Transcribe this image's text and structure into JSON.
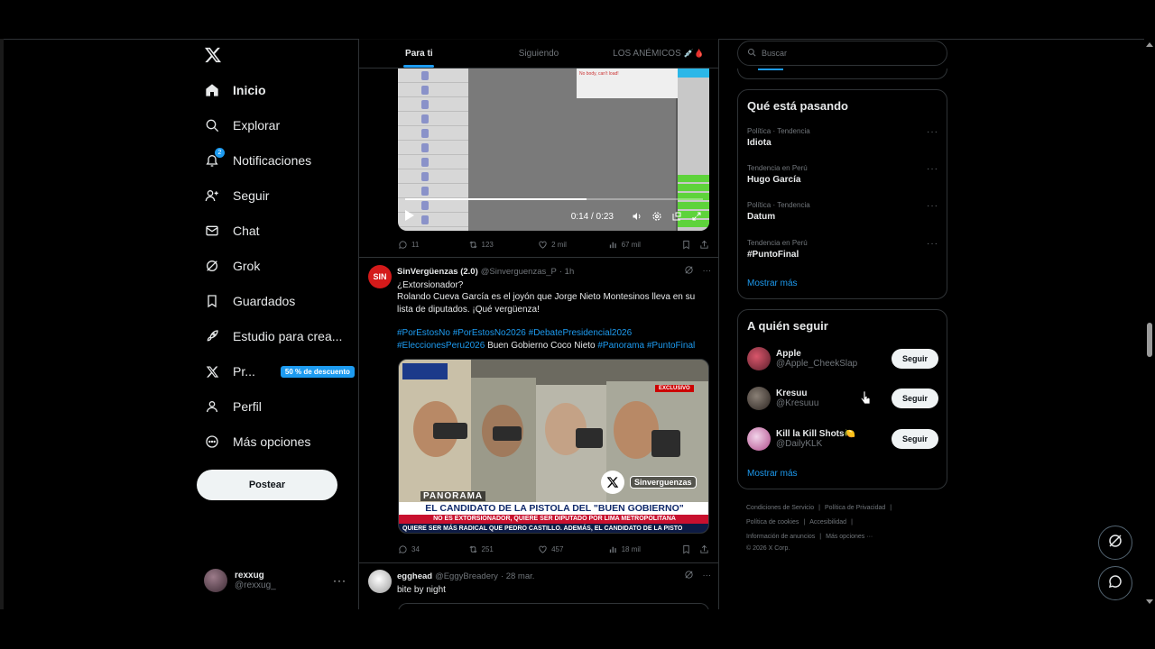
{
  "nav": {
    "items": [
      {
        "label": "Inicio",
        "icon": "home-icon"
      },
      {
        "label": "Explorar",
        "icon": "search-icon"
      },
      {
        "label": "Notificaciones",
        "icon": "bell-icon",
        "badge": "2"
      },
      {
        "label": "Seguir",
        "icon": "add-person-icon"
      },
      {
        "label": "Chat",
        "icon": "mail-icon"
      },
      {
        "label": "Grok",
        "icon": "grok-icon"
      },
      {
        "label": "Guardados",
        "icon": "bookmark-icon"
      },
      {
        "label": "Estudio para crea...",
        "icon": "rocket-icon"
      },
      {
        "label": "Pr...",
        "icon": "x-logo-icon",
        "promo": "50 % de descuento"
      },
      {
        "label": "Perfil",
        "icon": "person-icon"
      },
      {
        "label": "Más opciones",
        "icon": "more-circle-icon"
      }
    ],
    "post_label": "Postear",
    "account": {
      "name": "rexxug",
      "handle": "@rexxug_"
    }
  },
  "tabs": [
    {
      "label": "Para ti",
      "active": true
    },
    {
      "label": "Siguiendo",
      "active": false
    },
    {
      "label": "LOS ANÉMICOS",
      "emoji": "💉🩸",
      "active": false
    }
  ],
  "tweet1": {
    "video": {
      "time": "0:14 / 0:23",
      "progress": 0.61,
      "popup_text": "No body, can't load!"
    },
    "stats": {
      "replies": "11",
      "reposts": "123",
      "likes": "2 mil",
      "views": "67 mil"
    }
  },
  "tweet2": {
    "author": "SinVergüenzas (2.0)",
    "handle": "@Sinverguenzas_P",
    "time": "· 1h",
    "avatar_text": "SIN",
    "line1": "¿Extorsionador?",
    "line2": "Rolando Cueva García es el joyón que Jorge Nieto Montesinos lleva en su lista de diputados. ¡Qué vergüenza!",
    "tags_line1": "#PorEstosNo #PorEstosNo2026 #DebatePresidencial2026",
    "tags_line2_a": "#EleccionesPeru2026",
    "plain_mid": " Buen Gobierno Coco Nieto ",
    "tags_line2_b": "#Panorama #PuntoFinal",
    "image": {
      "exclusivo": "EXCLUSIVO",
      "panorama": "PANORAMA",
      "watermark": "Sinverguenzas",
      "headline": "EL CANDIDATO DE LA PISTOLA DEL \"BUEN GOBIERNO\"",
      "subline": "NO ES EXTORSIONADOR, QUIERE SER DIPUTADO POR LIMA METROPOLITANA",
      "crawl": "QUIERE SER MÁS RADICAL QUE PEDRO CASTILLO. ADEMÁS, EL CANDIDATO DE LA PISTO"
    },
    "stats": {
      "replies": "34",
      "reposts": "251",
      "likes": "457",
      "views": "18 mil"
    }
  },
  "tweet3": {
    "author": "egghead",
    "handle": "@EggyBreadery",
    "time": "· 28 mar.",
    "text": "bite by night"
  },
  "search": {
    "placeholder": "Buscar"
  },
  "trending": {
    "title": "Qué está pasando",
    "items": [
      {
        "context": "Política · Tendencia",
        "topic": "Idiota"
      },
      {
        "context": "Tendencia en Perú",
        "topic": "Hugo García"
      },
      {
        "context": "Política · Tendencia",
        "topic": "Datum"
      },
      {
        "context": "Tendencia en Perú",
        "topic": "#PuntoFinal"
      }
    ],
    "more": "Mostrar más"
  },
  "who_to_follow": {
    "title": "A quién seguir",
    "items": [
      {
        "name": "Apple",
        "handle": "@Apple_CheekSlap",
        "button": "Seguir"
      },
      {
        "name": "Kresuu",
        "handle": "@Kresuuu",
        "button": "Seguir"
      },
      {
        "name": "Kill la Kill Shots🍋",
        "handle": "@DailyKLK",
        "button": "Seguir"
      }
    ],
    "more": "Mostrar más"
  },
  "footer": {
    "links": [
      "Condiciones de Servicio",
      "Política de Privacidad",
      "Política de cookies",
      "Accesibilidad",
      "Información de anuncios",
      "Más opciones ···"
    ],
    "copyright": "© 2026 X Corp."
  },
  "colors": {
    "accent": "#1d9bf0",
    "background": "#000000",
    "text": "#e7e9ea",
    "muted": "#71767b",
    "border": "#2f3336"
  }
}
